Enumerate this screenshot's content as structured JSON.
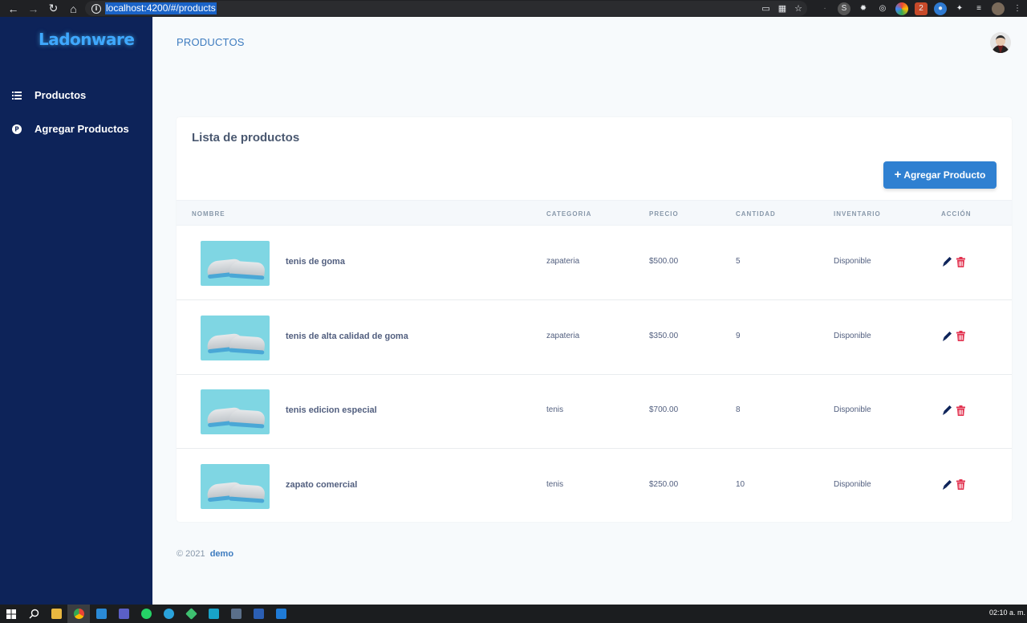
{
  "browser": {
    "url": "localhost:4200/#/products"
  },
  "sidebar": {
    "brand": "Ladonware",
    "items": [
      {
        "label": "Productos",
        "icon": "list-icon"
      },
      {
        "label": "Agregar Productos",
        "icon": "p-circle-icon"
      }
    ]
  },
  "header": {
    "title": "PRODUCTOS"
  },
  "card": {
    "title": "Lista de productos",
    "add_button": "Agregar Producto",
    "columns": [
      "NOMBRE",
      "CATEGORIA",
      "PRECIO",
      "CANTIDAD",
      "INVENTARIO",
      "ACCIÓN"
    ],
    "rows": [
      {
        "name": "tenis de goma",
        "category": "zapateria",
        "price": "$500.00",
        "quantity": "5",
        "inventory": "Disponible"
      },
      {
        "name": "tenis de alta calidad de goma",
        "category": "zapateria",
        "price": "$350.00",
        "quantity": "9",
        "inventory": "Disponible"
      },
      {
        "name": "tenis edicion especial",
        "category": "tenis",
        "price": "$700.00",
        "quantity": "8",
        "inventory": "Disponible"
      },
      {
        "name": "zapato comercial",
        "category": "tenis",
        "price": "$250.00",
        "quantity": "10",
        "inventory": "Disponible"
      }
    ]
  },
  "footer": {
    "copyright": "© 2021",
    "link": "demo"
  },
  "taskbar": {
    "clock": "02:10 a. m."
  },
  "colors": {
    "sidebar": "#0d2359",
    "accent": "#2f80d1",
    "edit": "#0d2359",
    "delete": "#e2324f"
  }
}
